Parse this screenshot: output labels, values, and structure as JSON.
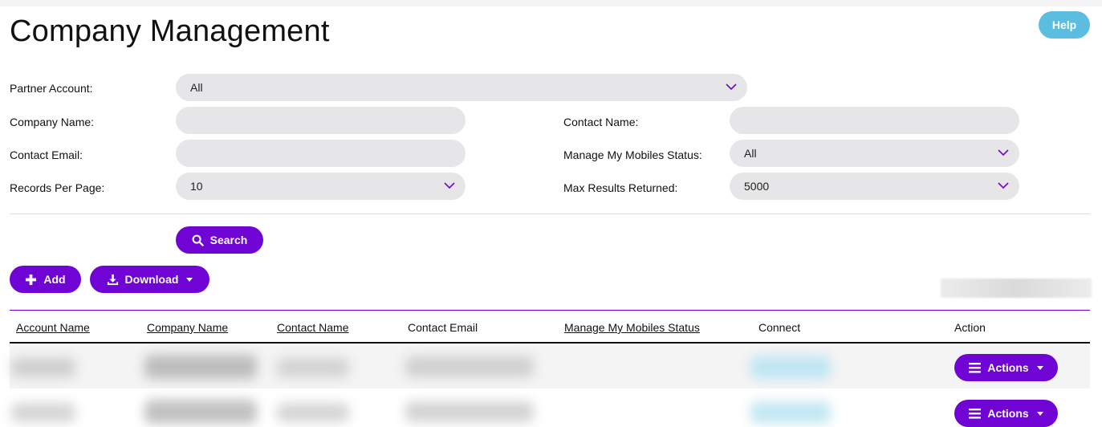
{
  "page": {
    "title": "Company Management",
    "help_label": "Help"
  },
  "filters": {
    "partner_account": {
      "label": "Partner Account:",
      "value": "All"
    },
    "company_name": {
      "label": "Company Name:",
      "value": ""
    },
    "contact_name": {
      "label": "Contact Name:",
      "value": ""
    },
    "contact_email": {
      "label": "Contact Email:",
      "value": ""
    },
    "mobiles_status": {
      "label": "Manage My Mobiles Status:",
      "value": "All"
    },
    "records_per_page": {
      "label": "Records Per Page:",
      "value": "10"
    },
    "max_results": {
      "label": "Max Results Returned:",
      "value": "5000"
    }
  },
  "buttons": {
    "search": "Search",
    "add": "Add",
    "download": "Download"
  },
  "table": {
    "columns": [
      "Account Name",
      "Company Name",
      "Contact Name",
      "Contact Email",
      "Manage My Mobiles Status",
      "Connect",
      "Action"
    ],
    "row_action_label": "Actions"
  },
  "colors": {
    "accent": "#6f04d4",
    "help": "#5bbde0",
    "field_bg": "#e6e6e8"
  }
}
